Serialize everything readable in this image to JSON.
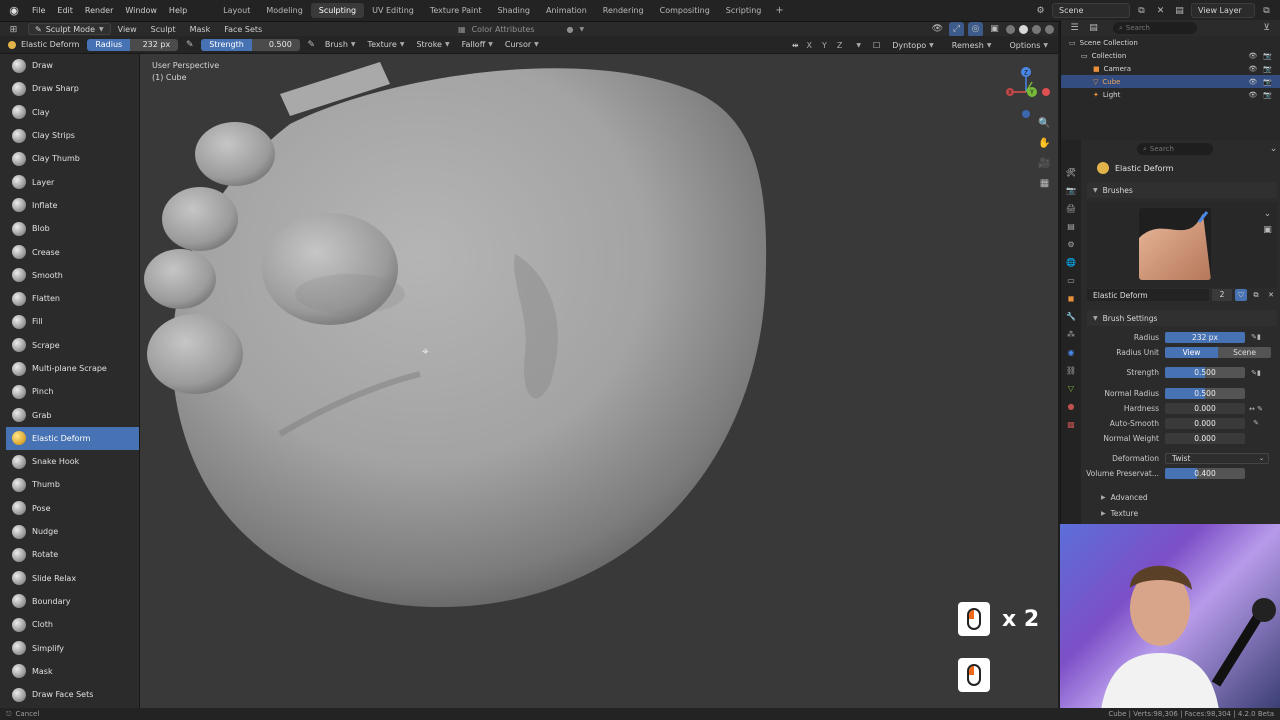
{
  "menubar": {
    "menus": [
      "File",
      "Edit",
      "Render",
      "Window",
      "Help"
    ],
    "workspaces": [
      "Layout",
      "Modeling",
      "Sculpting",
      "UV Editing",
      "Texture Paint",
      "Shading",
      "Animation",
      "Rendering",
      "Compositing",
      "Scripting"
    ],
    "active_workspace": "Sculpting",
    "scene_label": "Scene",
    "view_layer_label": "View Layer"
  },
  "viewport_header": {
    "mode": "Sculpt Mode",
    "menus": [
      "View",
      "Sculpt",
      "Mask",
      "Face Sets"
    ],
    "color_attributes": "Color Attributes"
  },
  "tool_header": {
    "brush_name": "Elastic Deform",
    "radius_label": "Radius",
    "radius_value": "232 px",
    "strength_label": "Strength",
    "strength_value": "0.500",
    "dropdowns": [
      "Brush",
      "Texture",
      "Stroke",
      "Falloff",
      "Cursor"
    ],
    "axes": [
      "X",
      "Y",
      "Z"
    ],
    "dyntopo": "Dyntopo",
    "remesh": "Remesh",
    "options": "Options"
  },
  "toolbar": {
    "brushes": [
      "Draw",
      "Draw Sharp",
      "Clay",
      "Clay Strips",
      "Clay Thumb",
      "Layer",
      "Inflate",
      "Blob",
      "Crease",
      "Smooth",
      "Flatten",
      "Fill",
      "Scrape",
      "Multi-plane Scrape",
      "Pinch",
      "Grab",
      "Elastic Deform",
      "Snake Hook",
      "Thumb",
      "Pose",
      "Nudge",
      "Rotate",
      "Slide Relax",
      "Boundary",
      "Cloth",
      "Simplify",
      "Mask",
      "Draw Face Sets"
    ],
    "active": "Elastic Deform"
  },
  "viewport": {
    "perspective": "User Perspective",
    "object": "(1) Cube",
    "mouse_count": "x 2",
    "gizmo_x": "X",
    "gizmo_y": "Y",
    "gizmo_z": "Z"
  },
  "outliner": {
    "search_placeholder": "Search",
    "items": [
      {
        "label": "Scene Collection",
        "indent": 0,
        "selected": false
      },
      {
        "label": "Collection",
        "indent": 1,
        "selected": false
      },
      {
        "label": "Camera",
        "indent": 2,
        "selected": false
      },
      {
        "label": "Cube",
        "indent": 2,
        "selected": true
      },
      {
        "label": "Light",
        "indent": 2,
        "selected": false
      }
    ]
  },
  "properties": {
    "search_placeholder": "Search",
    "panel_title": "Elastic Deform",
    "brushes_section": "Brushes",
    "brush_name": "Elastic Deform",
    "brush_users": "2",
    "brush_settings_section": "Brush Settings",
    "radius_label": "Radius",
    "radius_value": "232 px",
    "radius_unit_label": "Radius Unit",
    "radius_unit_options": [
      "View",
      "Scene"
    ],
    "strength_label": "Strength",
    "strength_value": "0.500",
    "strength_fraction": 0.5,
    "normal_radius_label": "Normal Radius",
    "normal_radius_value": "0.500",
    "normal_radius_fraction": 0.5,
    "hardness_label": "Hardness",
    "hardness_value": "0.000",
    "auto_smooth_label": "Auto-Smooth",
    "auto_smooth_value": "0.000",
    "normal_weight_label": "Normal Weight",
    "normal_weight_value": "0.000",
    "deformation_label": "Deformation",
    "deformation_value": "Twist",
    "volume_label": "Volume Preservat...",
    "volume_value": "0.400",
    "volume_fraction": 0.4,
    "advanced": "Advanced",
    "texture": "Texture"
  },
  "statusbar": {
    "left": "Cancel",
    "right": "Cube | Verts:98,306 | Faces:98,304 | 4.2.0 Beta"
  },
  "colors": {
    "accent": "#4772b3",
    "brush_gold": "#e2b24b",
    "viewport_bg": "#393939"
  }
}
